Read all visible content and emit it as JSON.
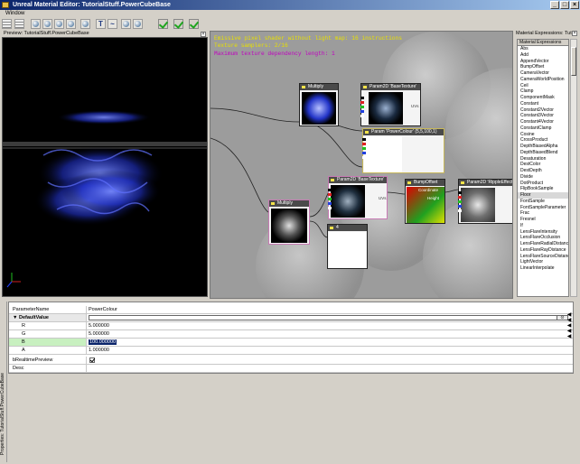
{
  "window": {
    "title": "Unreal Material Editor: TutorialStuff.PowerCubeBase"
  },
  "menu": {
    "window": "Window"
  },
  "preview": {
    "title": "Preview: TutorialStuff.PowerCubeBase"
  },
  "info": {
    "line1": "Emissive pixel shader without light map: 16 instructions",
    "line2": "Texture samplers: 2/16",
    "line3": "Maximum texture dependency length: 1"
  },
  "nodes": {
    "multiply1": "Multiply",
    "param_base1": "Param2D 'BaseTexture'",
    "uvs1": "UVs",
    "power_colour": "Param 'PowerColour' (5,5,100,1)",
    "multiply2": "Multiply",
    "param_base2": "Param2D 'BaseTexture'",
    "uvs2": "UVs",
    "bump_offset": "BumpOffset",
    "coordinate": "Coordinate",
    "height": "Height",
    "param_ripple": "Param2D 'RippleEffect'",
    "const4": "4"
  },
  "expressions": {
    "panel_title": "Material Expressions: Tuto",
    "list_header": "Material Expressions",
    "items": [
      "Abs",
      "Add",
      "AppendVector",
      "BumpOffset",
      "CameraVector",
      "CameraWorldPosition",
      "Ceil",
      "Clamp",
      "ComponentMask",
      "Constant",
      "Constant2Vector",
      "Constant3Vector",
      "Constant4Vector",
      "ConstantClamp",
      "Cosine",
      "CrossProduct",
      "DepthBiasedAlpha",
      "DepthBiasedBlend",
      "Desaturation",
      "DestColor",
      "DestDepth",
      "Divide",
      "DotProduct",
      "FlipBookSample",
      "Floor",
      "FontSample",
      "FontSampleParameter",
      "Frac",
      "Fresnel",
      "If",
      "LensFlareIntensity",
      "LensFlareOcclusion",
      "LensFlareRadialDistance",
      "LensFlareRayDistance",
      "LensFlareSourceDistance",
      "LightVector",
      "LinearInterpolate"
    ]
  },
  "properties": {
    "side_label": "Properties: TutorialStuff.PowerCubeBase",
    "rows": [
      {
        "key": "ParameterName",
        "value": "PowerColour"
      },
      {
        "key": "DefaultValue",
        "value": ""
      },
      {
        "key": "R",
        "value": "5.000000"
      },
      {
        "key": "G",
        "value": "5.000000"
      },
      {
        "key": "B",
        "value": "100.000000"
      },
      {
        "key": "A",
        "value": "1.000000"
      },
      {
        "key": "bRealtimePreview",
        "value": ""
      },
      {
        "key": "Desc",
        "value": ""
      }
    ]
  }
}
